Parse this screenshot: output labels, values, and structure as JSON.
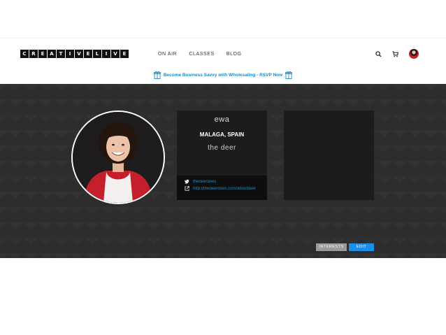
{
  "header": {
    "logo_letters": [
      "C",
      "R",
      "E",
      "A",
      "T",
      "I",
      "V",
      "E",
      "L",
      "I",
      "V",
      "E"
    ],
    "nav": [
      {
        "label": "ON AIR"
      },
      {
        "label": "CLASSES"
      },
      {
        "label": "BLOG"
      }
    ],
    "icons": {
      "search": "search-icon",
      "cart": "cart-icon",
      "avatar": "user-avatar"
    }
  },
  "promo": {
    "text": "Become Business Savvy with Wholesaling - RSVP Now",
    "icon": "gift-icon",
    "color": "#1e8bc3"
  },
  "profile": {
    "name": "ewa",
    "location": "MALAGA, SPAIN",
    "tagline": "the deer",
    "links": [
      {
        "icon": "twitter-icon",
        "text": "thedeerdoes"
      },
      {
        "icon": "external-link-icon",
        "text": "http://thedeerdoes.com/aboutdeer"
      }
    ]
  },
  "actions": {
    "interests_label": "INTERESTS",
    "edit_label": "EDIT"
  },
  "colors": {
    "banner": "#2d2d2d",
    "accent": "#1b8ee6",
    "link": "#1e8bc3"
  }
}
